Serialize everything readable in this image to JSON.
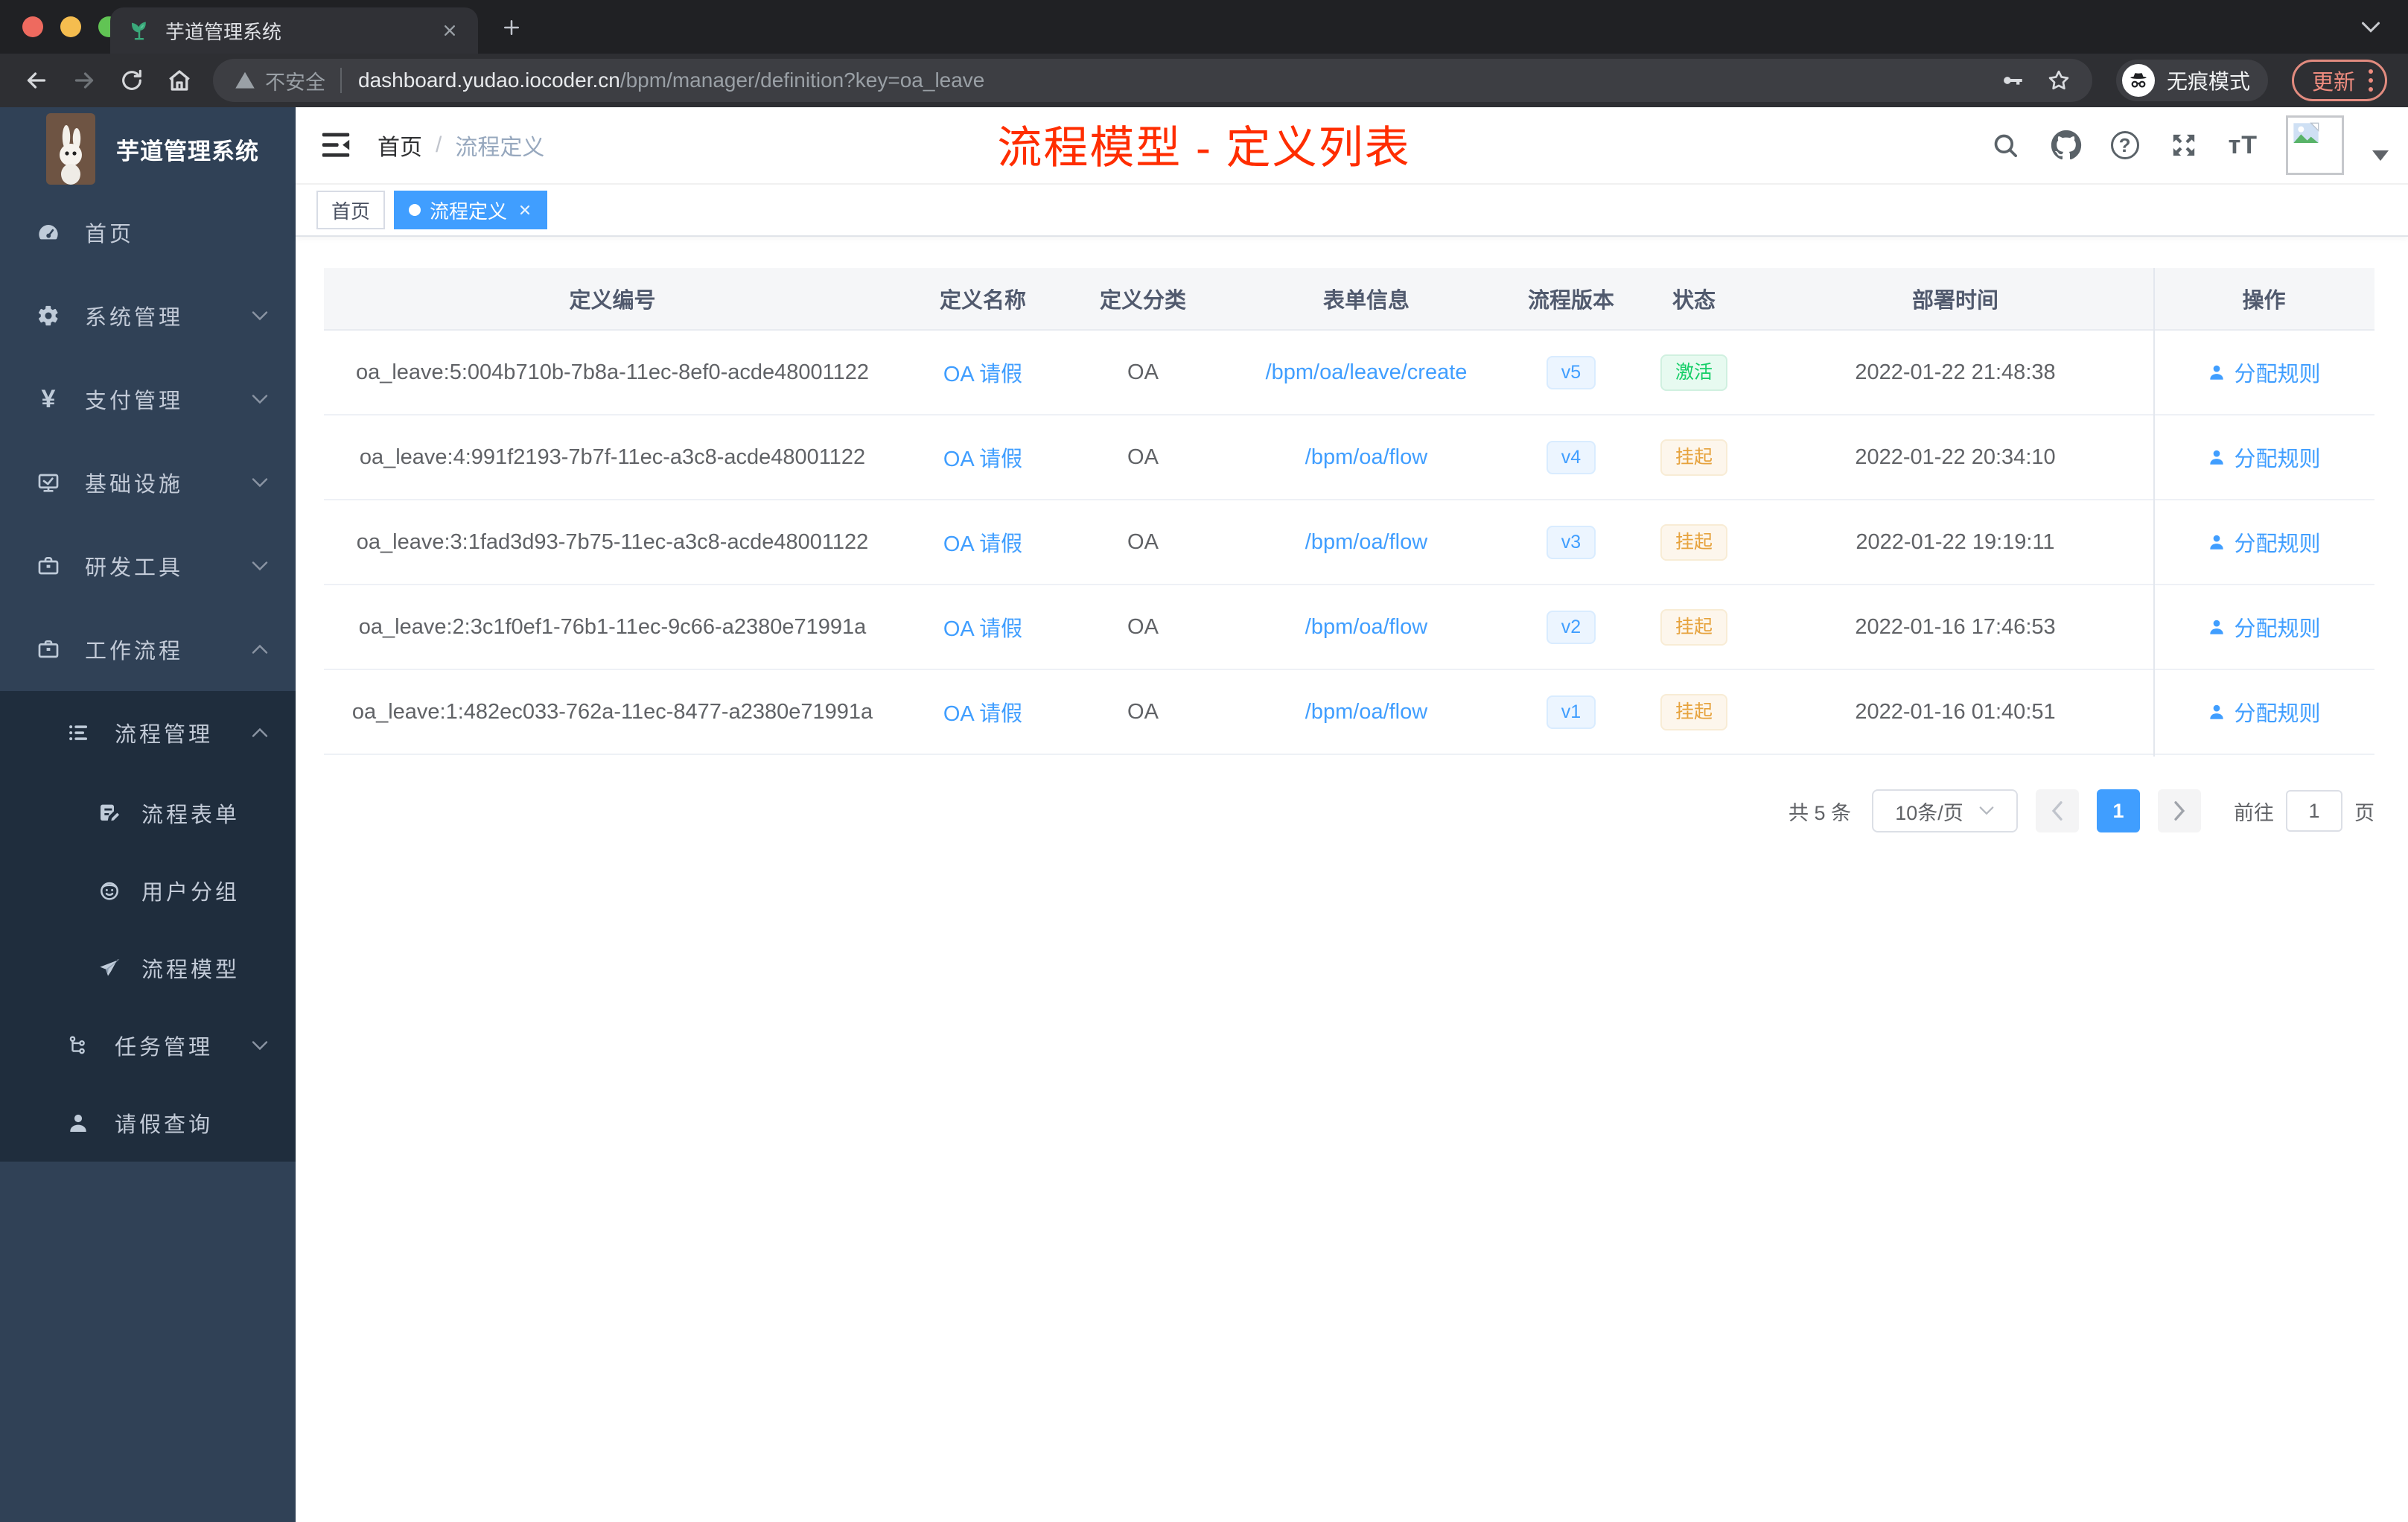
{
  "browser": {
    "tab_title": "芋道管理系统",
    "security_label": "不安全",
    "url_host": "dashboard.yudao.iocoder.cn",
    "url_path": "/bpm/manager/definition?key=oa_leave",
    "incognito_label": "无痕模式",
    "update_label": "更新"
  },
  "annotation": {
    "title": "流程模型 - 定义列表",
    "color": "#ff2d00"
  },
  "sidebar": {
    "logo_title": "芋道管理系统",
    "items": [
      {
        "label": "首页",
        "icon": "dashboard-icon"
      },
      {
        "label": "系统管理",
        "icon": "gear-icon"
      },
      {
        "label": "支付管理",
        "icon": "yen-icon"
      },
      {
        "label": "基础设施",
        "icon": "monitor-icon"
      },
      {
        "label": "研发工具",
        "icon": "toolbox-icon"
      },
      {
        "label": "工作流程",
        "icon": "briefcase-icon"
      }
    ],
    "workflow_children": [
      {
        "label": "流程管理",
        "icon": "list-tree-icon"
      },
      {
        "label": "流程表单",
        "icon": "form-edit-icon"
      },
      {
        "label": "用户分组",
        "icon": "user-group-icon"
      },
      {
        "label": "流程模型",
        "icon": "paper-plane-icon"
      },
      {
        "label": "任务管理",
        "icon": "org-tree-icon"
      },
      {
        "label": "请假查询",
        "icon": "user-icon"
      }
    ]
  },
  "navbar": {
    "breadcrumb_home": "首页",
    "breadcrumb_sep": "/",
    "breadcrumb_current": "流程定义"
  },
  "tags": [
    {
      "label": "首页",
      "active": false
    },
    {
      "label": "流程定义",
      "active": true
    }
  ],
  "table": {
    "columns": [
      "定义编号",
      "定义名称",
      "定义分类",
      "表单信息",
      "流程版本",
      "状态",
      "部署时间",
      "操作"
    ],
    "rows": [
      {
        "id": "oa_leave:5:004b710b-7b8a-11ec-8ef0-acde48001122",
        "name": "OA 请假",
        "category": "OA",
        "form": "/bpm/oa/leave/create",
        "version": "v5",
        "status": "激活",
        "status_type": "success",
        "deploy_time": "2022-01-22 21:48:38",
        "action": "分配规则"
      },
      {
        "id": "oa_leave:4:991f2193-7b7f-11ec-a3c8-acde48001122",
        "name": "OA 请假",
        "category": "OA",
        "form": "/bpm/oa/flow",
        "version": "v4",
        "status": "挂起",
        "status_type": "warning",
        "deploy_time": "2022-01-22 20:34:10",
        "action": "分配规则"
      },
      {
        "id": "oa_leave:3:1fad3d93-7b75-11ec-a3c8-acde48001122",
        "name": "OA 请假",
        "category": "OA",
        "form": "/bpm/oa/flow",
        "version": "v3",
        "status": "挂起",
        "status_type": "warning",
        "deploy_time": "2022-01-22 19:19:11",
        "action": "分配规则"
      },
      {
        "id": "oa_leave:2:3c1f0ef1-76b1-11ec-9c66-a2380e71991a",
        "name": "OA 请假",
        "category": "OA",
        "form": "/bpm/oa/flow",
        "version": "v2",
        "status": "挂起",
        "status_type": "warning",
        "deploy_time": "2022-01-16 17:46:53",
        "action": "分配规则"
      },
      {
        "id": "oa_leave:1:482ec033-762a-11ec-8477-a2380e71991a",
        "name": "OA 请假",
        "category": "OA",
        "form": "/bpm/oa/flow",
        "version": "v1",
        "status": "挂起",
        "status_type": "warning",
        "deploy_time": "2022-01-16 01:40:51",
        "action": "分配规则"
      }
    ]
  },
  "pagination": {
    "total": "共 5 条",
    "page_size": "10条/页",
    "page": "1",
    "goto_label": "前往",
    "goto_value": "1",
    "unit_label": "页"
  },
  "colors": {
    "accent": "#409eff",
    "success": "#13ce66",
    "warning": "#e6a23c",
    "sidebar": "#304156",
    "submenu": "#1f2d3d"
  }
}
